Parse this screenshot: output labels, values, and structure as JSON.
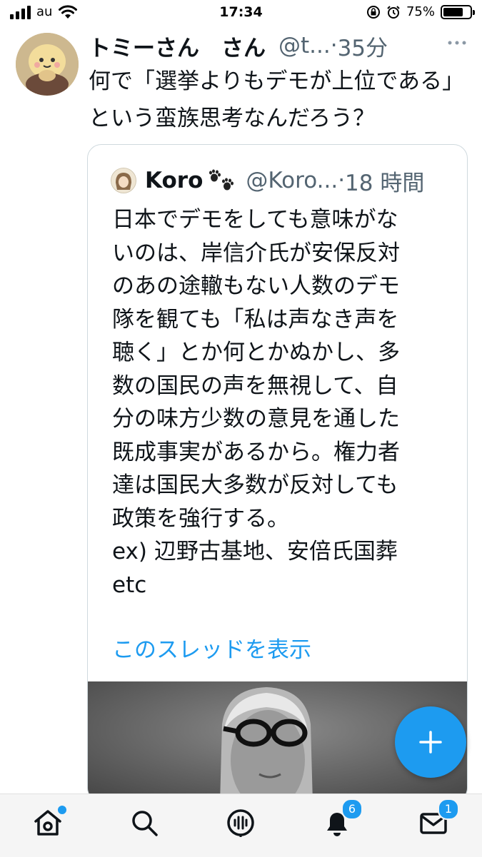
{
  "status_bar": {
    "carrier": "au",
    "time": "17:34",
    "battery_percent_label": "75%",
    "battery_level": 0.75
  },
  "tweet": {
    "author_name": "トミーさん　さん",
    "handle": "@t...",
    "separator": "·",
    "time_ago": "35分",
    "text": "何で「選挙よりもデモが上位である」という蛮族思考なんだろう？"
  },
  "quoted_tweet": {
    "author_name": "Koro",
    "handle": "@Koro...",
    "separator": "·",
    "time_ago": "18 時間",
    "lines": [
      "日本でデモをしても意味がな",
      "いのは、岸信介氏が安保反対",
      "のあの途轍もない人数のデモ",
      "隊を観ても「私は声なき声を",
      "聴く」とか何とかぬかし、多",
      "数の国民の声を無視して、自",
      "分の味方少数の意見を通した",
      "既成事実があるから。権力者",
      "達は国民大多数が反対しても",
      "政策を強行する。",
      "ex) 辺野古基地、安倍氏国葬",
      "etc"
    ],
    "thread_link": "このスレッドを表示"
  },
  "bottom_nav": {
    "items": [
      "home-icon",
      "search-icon",
      "spaces-icon",
      "notifications-icon",
      "messages-icon"
    ],
    "notifications_badge": "6",
    "messages_badge": "1"
  },
  "colors": {
    "accent": "#1d9bf0",
    "text": "#0f1419",
    "secondary_text": "#536471",
    "border": "#cfd9de"
  }
}
